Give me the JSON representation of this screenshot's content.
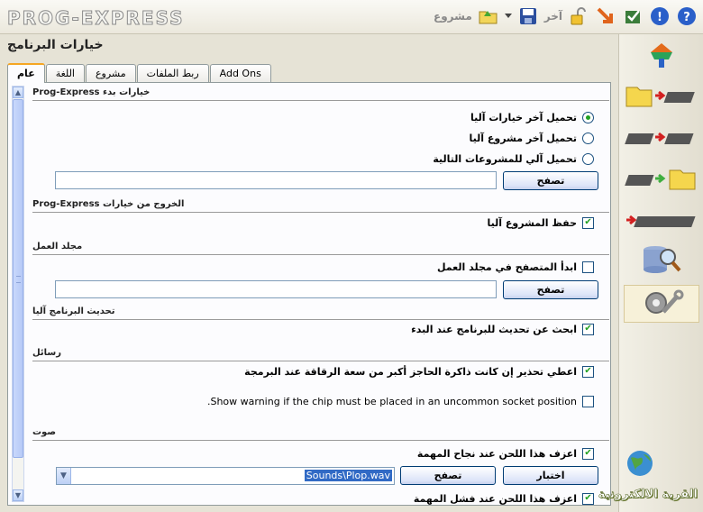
{
  "app": {
    "logo": "PROG-EXPRESS"
  },
  "toolbar": {
    "project_label": "مشروع",
    "other_label": "آخر"
  },
  "page": {
    "title": "خيارات البرنامج"
  },
  "tabs": [
    {
      "label": "عام",
      "active": true
    },
    {
      "label": "اللغة"
    },
    {
      "label": "مشروع"
    },
    {
      "label": "ربط الملفات"
    },
    {
      "label": "Add Ons"
    }
  ],
  "sections": {
    "startup": "Prog-Express خيارات بدء",
    "exit": "Prog-Express الخروج من خيارات",
    "workdir": "مجلد العمل",
    "update": "تحديث البرنامج آليا",
    "messages": "رسائل",
    "sound": "صوت"
  },
  "startup": {
    "opt1": "تحميل آخر خيارات آليا",
    "opt2": "تحميل آخر مشروع آليا",
    "opt3": "تحميل آلي للمشروعات التالية",
    "selected": 1,
    "path_value": "",
    "browse": "تصفح"
  },
  "exit": {
    "save_project": "حفظ المشروع آليا",
    "save_checked": true
  },
  "workdir": {
    "start_browser": "ابدأ المتصفح في مجلد العمل",
    "checked": false,
    "path_value": "",
    "browse": "تصفح"
  },
  "update": {
    "check_updates": "ابحث عن تحديث للبرنامج عند البدء",
    "checked": true
  },
  "messages": {
    "warn_buffer": "اعطي تحذير إن كانت ذاكرة الحاجز أكبر من سعة الرقاقة عند البرمجة",
    "warn_buffer_checked": true,
    "warn_socket": "Show warning if the chip must be placed in an uncommon socket position.",
    "warn_socket_checked": false
  },
  "sound": {
    "play_success": "اعزف هذا اللحن عند نجاح المهمة",
    "success_checked": true,
    "test": "اختبار",
    "browse": "تصفح",
    "file": "Sounds\\Plop.wav",
    "play_fail": "اعزف هذا اللحن عند فشل المهمة",
    "fail_checked": true
  },
  "brand": {
    "text": "القرية الالكترونية"
  },
  "colors": {
    "accent": "#f5a623",
    "check": "#21a121",
    "selection": "#316ac5"
  }
}
